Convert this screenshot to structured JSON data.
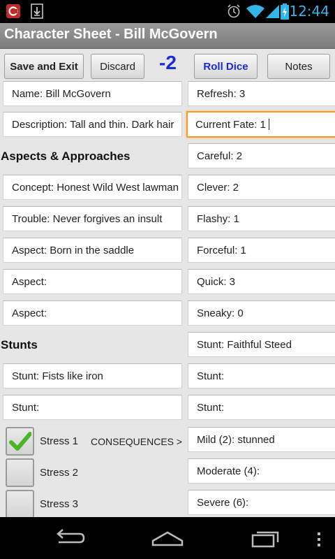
{
  "status_bar": {
    "time": "12:44",
    "icons": [
      "app-notification-icon",
      "download-icon",
      "alarm-icon",
      "wifi-icon",
      "signal-icon",
      "battery-charging-icon"
    ]
  },
  "title": "Character Sheet - Bill McGovern",
  "toolbar": {
    "save_exit": "Save and Exit",
    "discard": "Discard",
    "dice_result": "-2",
    "roll_dice": "Roll Dice",
    "notes": "Notes"
  },
  "left_fields": {
    "name": "Name: Bill McGovern",
    "description": "Description: Tall and thin. Dark hair"
  },
  "aspects": {
    "heading": "Aspects & Approaches",
    "concept": "Concept: Honest Wild West lawman",
    "trouble": "Trouble: Never forgives an insult",
    "aspect1": "Aspect: Born in the saddle",
    "aspect2": "Aspect:",
    "aspect3": "Aspect:"
  },
  "stunts": {
    "heading": "Stunts",
    "stunt1": "Stunt: Fists like iron",
    "stunt2": "Stunt:"
  },
  "right_fields": {
    "refresh": "Refresh: 3",
    "current_fate": "Current Fate: 1",
    "careful": "Careful: 2",
    "clever": "Clever: 2",
    "flashy": "Flashy: 1",
    "forceful": "Forceful: 1",
    "quick": "Quick: 3",
    "sneaky": "Sneaky: 0",
    "stunt_a": "Stunt: Faithful Steed",
    "stunt_b": "Stunt:",
    "stunt_c": "Stunt:"
  },
  "stress": {
    "s1": "Stress 1",
    "s2": "Stress 2",
    "s3": "Stress 3",
    "s1_checked": true,
    "s2_checked": false,
    "s3_checked": false
  },
  "consequences": {
    "label": "CONSEQUENCES >",
    "mild": "Mild (2): stunned",
    "moderate": "Moderate (4):",
    "severe": "Severe (6):"
  },
  "nav": {
    "icons": [
      "back-icon",
      "home-icon",
      "recent-apps-icon",
      "menu-icon"
    ]
  },
  "colors": {
    "accent_blue": "#1a2bd8",
    "focus_orange": "#ff9a1a",
    "status_blue": "#33b5e5",
    "check_green": "#4ab528"
  }
}
